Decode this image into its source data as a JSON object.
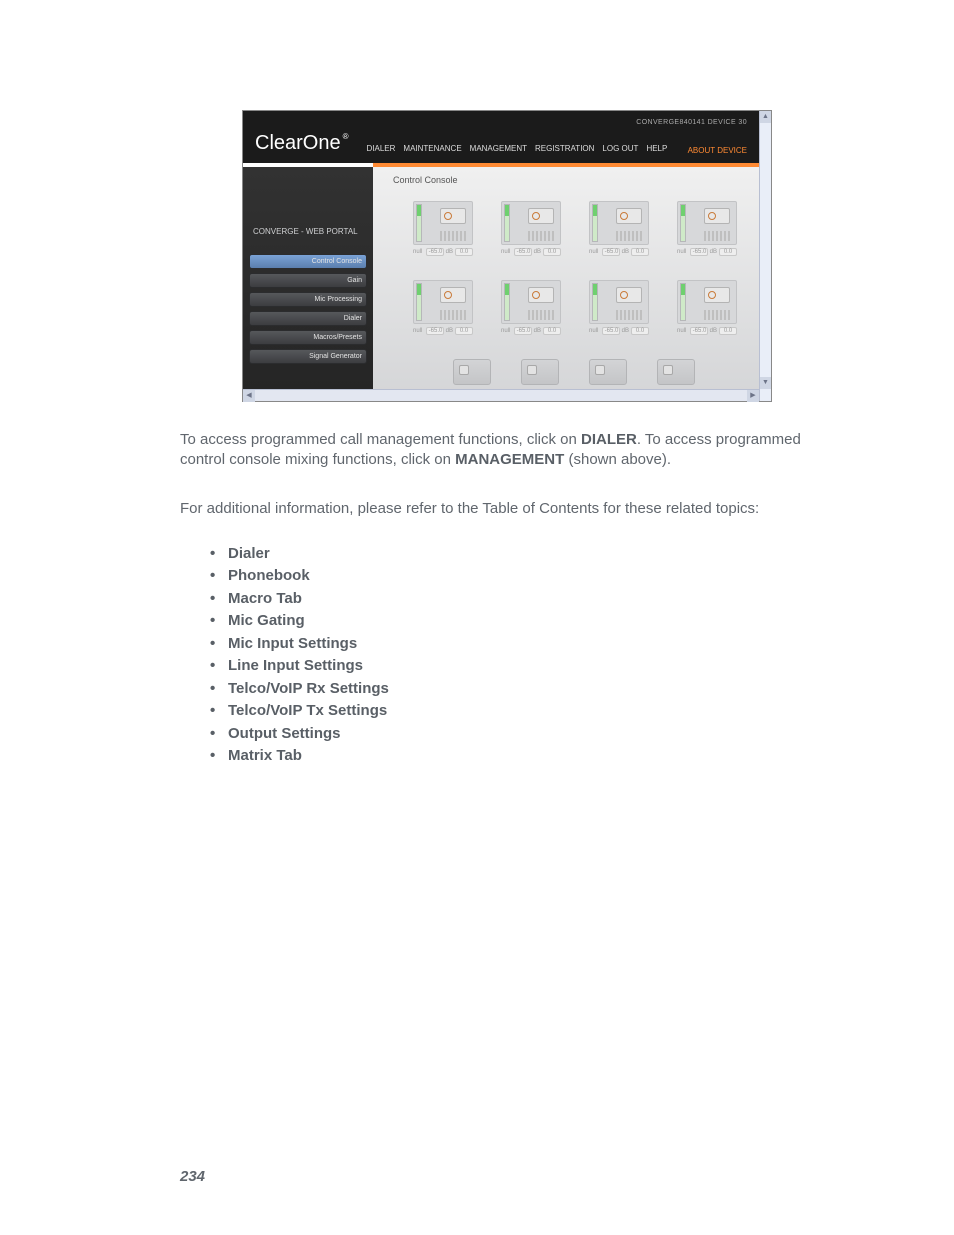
{
  "screenshot": {
    "device_label": "CONVERGE840141 DEVICE 30",
    "brand": "ClearOne",
    "nav": {
      "dialer": "DIALER",
      "maintenance": "MAINTENANCE",
      "management": "MANAGEMENT",
      "registration": "REGISTRATION",
      "logout": "LOG OUT",
      "help": "HELP",
      "about": "ABOUT DEVICE"
    },
    "sidebar": {
      "title": "CONVERGE - WEB PORTAL",
      "items": [
        "Control Console",
        "Gain",
        "Mic Processing",
        "Dialer",
        "Macros/Presets",
        "Signal Generator"
      ]
    },
    "content_title": "Control Console",
    "tiles": [
      {
        "lbl": "null",
        "db": "-65.0",
        "unit": "dB",
        "gain": "0.0"
      },
      {
        "lbl": "null",
        "db": "-65.0",
        "unit": "dB",
        "gain": "0.0"
      },
      {
        "lbl": "null",
        "db": "-65.0",
        "unit": "dB",
        "gain": "0.0"
      },
      {
        "lbl": "null",
        "db": "-65.0",
        "unit": "dB",
        "gain": "0.0"
      },
      {
        "lbl": "null",
        "db": "-65.0",
        "unit": "dB",
        "gain": "0.0"
      },
      {
        "lbl": "null",
        "db": "-65.0",
        "unit": "dB",
        "gain": "0.0"
      },
      {
        "lbl": "null",
        "db": "-65.0",
        "unit": "dB",
        "gain": "0.0"
      },
      {
        "lbl": "null",
        "db": "-65.0",
        "unit": "dB",
        "gain": "0.0"
      }
    ]
  },
  "body": {
    "p1_a": "To access programmed call management functions, click on ",
    "p1_b": "DIALER",
    "p1_c": ". To access programmed control console mixing functions, click on ",
    "p1_d": "MANAGEMENT",
    "p1_e": " (shown above).",
    "p2": "For additional information, please refer to the Table of Contents for these related topics:",
    "topics": [
      "Dialer",
      "Phonebook",
      "Macro Tab",
      "Mic Gating",
      "Mic Input Settings",
      "Line Input Settings",
      "Telco/VoIP Rx Settings",
      "Telco/VoIP Tx Settings",
      "Output Settings",
      "Matrix Tab"
    ]
  },
  "page_number": "234"
}
